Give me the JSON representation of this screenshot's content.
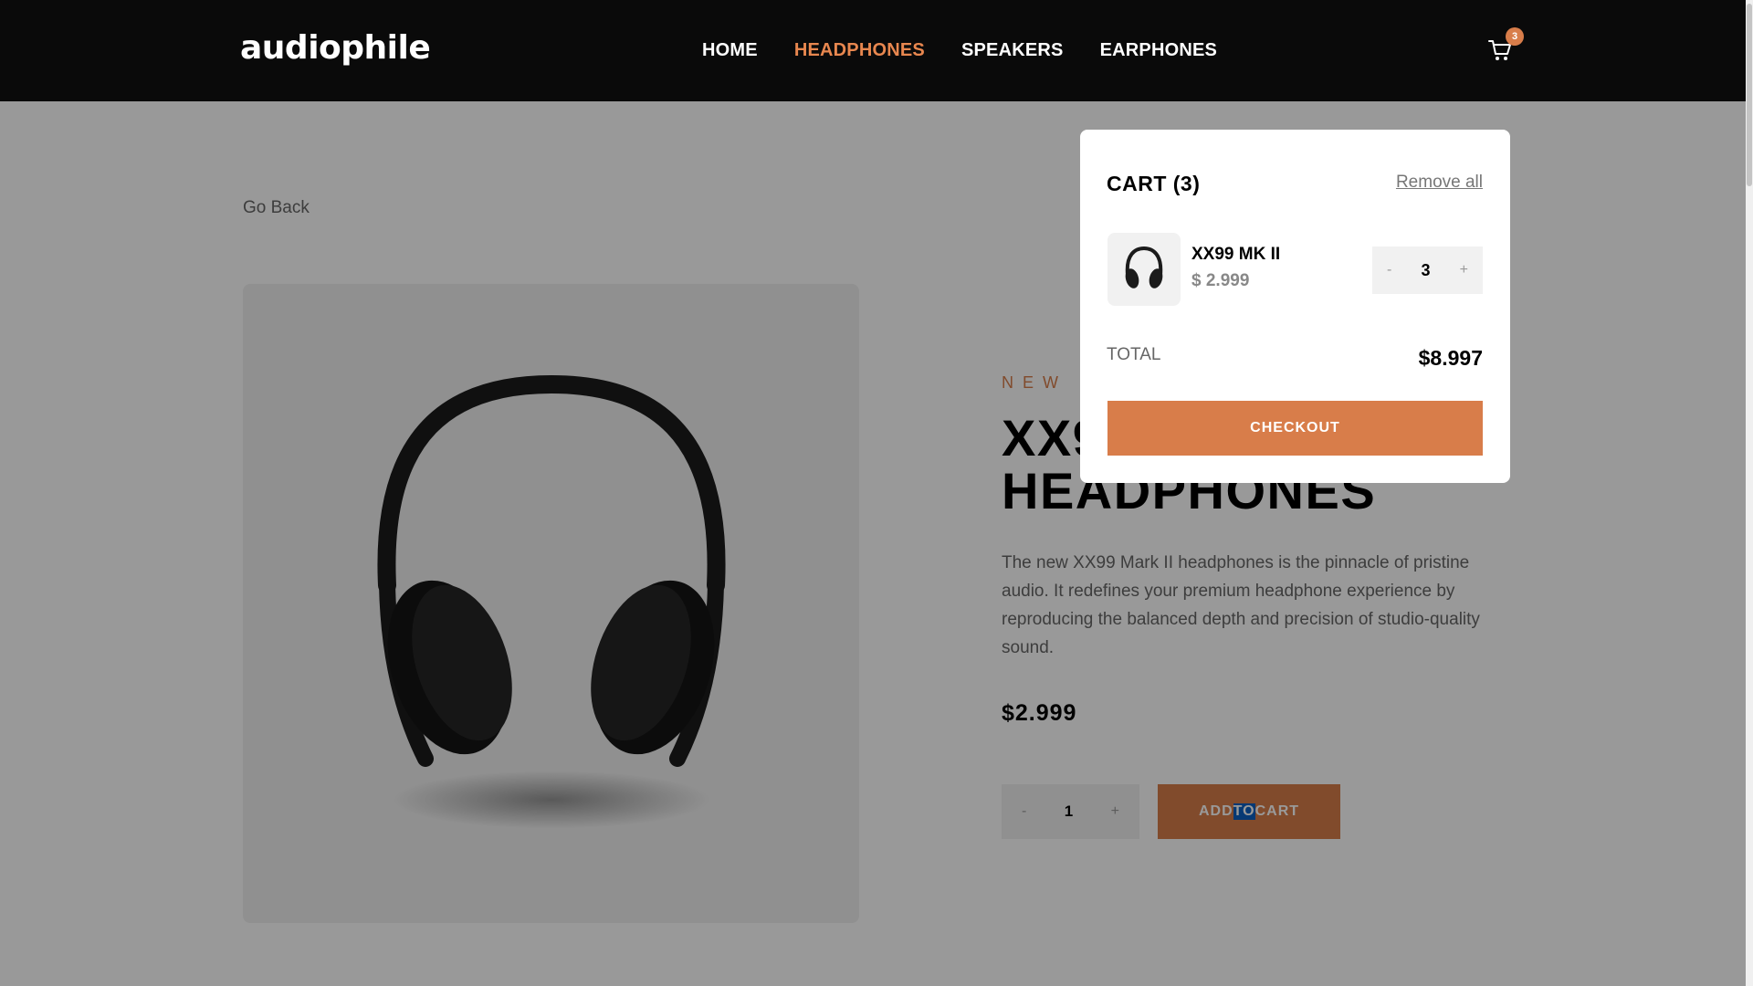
{
  "header": {
    "logo": "audiophile",
    "nav": [
      "HOME",
      "HEADPHONES",
      "SPEAKERS",
      "EARPHONES"
    ],
    "active_nav": "HEADPHONES",
    "cart_count": "3",
    "cart_icon": "cart-icon"
  },
  "page": {
    "go_back": "Go Back",
    "new_label": "NEW PRODUCT",
    "title_line1": "XX99 MARK II",
    "title_line2": "HEADPHONES",
    "description": "The new XX99 Mark II headphones is the pinnacle of pristine audio. It redefines your premium headphone experience by reproducing the balanced depth and precision of studio-quality sound.",
    "price": "$2.999",
    "qty_minus": "-",
    "qty_value": "1",
    "qty_plus": "+",
    "add_to_cart": [
      "ADD ",
      "TO",
      " CART"
    ]
  },
  "cart": {
    "title": "CART (3)",
    "remove_all": "Remove all",
    "items": [
      {
        "name": "XX99 MK II",
        "price": "$ 2.999",
        "qty": "3",
        "minus": "-",
        "plus": "+"
      }
    ],
    "total_label": "TOTAL",
    "total_value": "$8.997",
    "checkout": "CHECKOUT"
  },
  "colors": {
    "accent": "#d87d4a",
    "header_bg": "#0a0a0a",
    "overlay": "rgba(0,0,0,0.4)"
  }
}
